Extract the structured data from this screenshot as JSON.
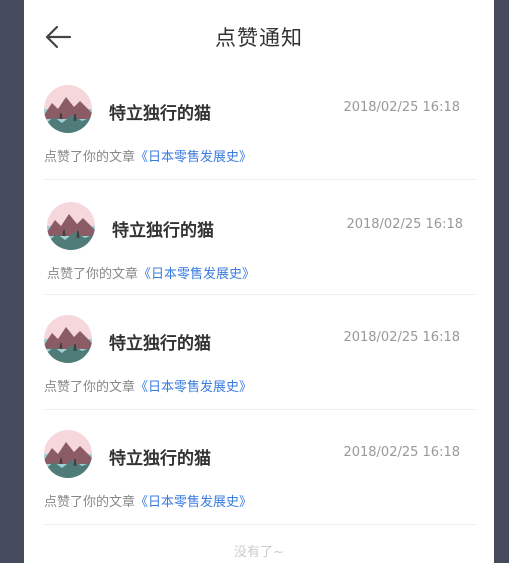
{
  "header": {
    "title": "点赞通知",
    "back_icon": "arrow-left-icon"
  },
  "notifications": [
    {
      "user": "特立独行的猫",
      "time": "2018/02/25  16:18",
      "action_text": "点赞了你的文章",
      "article": "《日本零售发展史》"
    },
    {
      "user": "特立独行的猫",
      "time": "2018/02/25  16:18",
      "action_text": "点赞了你的文章",
      "article": "《日本零售发展史》"
    },
    {
      "user": "特立独行的猫",
      "time": "2018/02/25  16:18",
      "action_text": "点赞了你的文章",
      "article": "《日本零售发展史》"
    },
    {
      "user": "特立独行的猫",
      "time": "2018/02/25  16:18",
      "action_text": "点赞了你的文章",
      "article": "《日本零售发展史》"
    }
  ],
  "footer": {
    "text": "没有了~"
  },
  "colors": {
    "background": "#454b5d",
    "panel": "#ffffff",
    "link": "#3a7be0",
    "muted": "#999999"
  }
}
